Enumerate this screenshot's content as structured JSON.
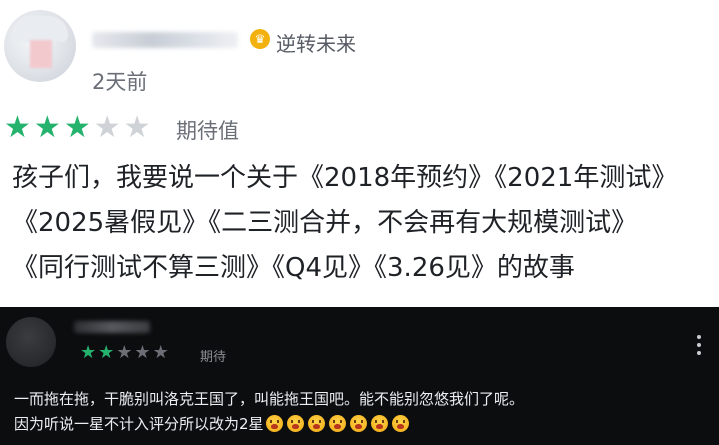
{
  "review_main": {
    "badge_label": "逆转未来",
    "time_ago": "2天前",
    "rating": {
      "value": 3,
      "max": 5,
      "label": "期待值"
    },
    "content_lines": [
      "孩子们，我要说一个关于《2018年预约》《2021年测试》",
      "《2025暑假见》《二三测合并，不会再有大规模测试》",
      "《同行测试不算三测》《Q4见》《3.26见》的故事"
    ]
  },
  "review_reply": {
    "rating": {
      "value": 2,
      "max": 5,
      "label": "期待"
    },
    "content_lines": [
      "一而拖在拖，干脆别叫洛克王国了，叫能拖王国吧。能不能别忽悠我们了呢。",
      "因为听说一星不计入评分所以改为2星"
    ],
    "emoji_count": 7
  },
  "colors": {
    "star_active": "#24b26d",
    "badge": "#f2b10f",
    "dark_bg": "#0c0d0f"
  },
  "icons": [
    "star-icon",
    "crown-badge-icon",
    "more-options-icon",
    "crying-face-emoji"
  ]
}
